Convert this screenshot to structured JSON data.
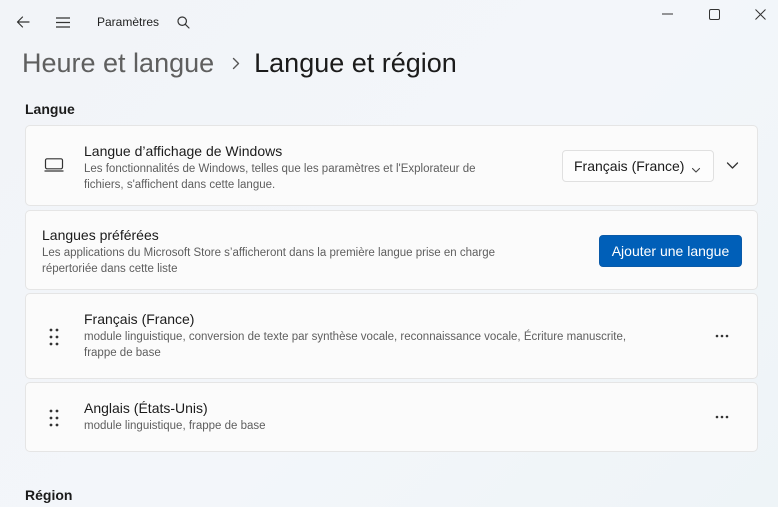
{
  "app": {
    "title": "Paramètres"
  },
  "breadcrumb": {
    "parent": "Heure et langue",
    "current": "Langue et région"
  },
  "sections": {
    "language_title": "Langue",
    "region_title": "Région"
  },
  "display_language": {
    "title": "Langue d’affichage de Windows",
    "description_line1": "Les fonctionnalités de Windows, telles que les paramètres et l'Explorateur de",
    "description_line2": "fichiers, s'affichent dans cette langue.",
    "selected_value": "Français (France)"
  },
  "preferred_languages": {
    "title": "Langues préférées",
    "description_line1": "Les applications du Microsoft Store s’afficheront dans la première langue prise en charge",
    "description_line2": "répertoriée dans cette liste",
    "add_button_label": "Ajouter une langue"
  },
  "languages": [
    {
      "name": "Français (France)",
      "features_line1": "module linguistique, conversion de texte par synthèse vocale, reconnaissance vocale, Écriture manuscrite,",
      "features_line2": "frappe de base"
    },
    {
      "name": "Anglais (États-Unis)",
      "features_line1": "module linguistique, frappe de base"
    }
  ],
  "icons": {
    "back": "back-arrow-icon",
    "menu": "hamburger-menu-icon",
    "search": "search-icon",
    "minimize": "minimize-icon",
    "maximize": "maximize-icon",
    "close": "close-icon",
    "display": "display-icon",
    "drag": "drag-handle-icon",
    "more": "more-options-icon"
  },
  "colors": {
    "accent": "#005fb8",
    "background": "#f3f6fa",
    "card": "#fbfbfb"
  }
}
